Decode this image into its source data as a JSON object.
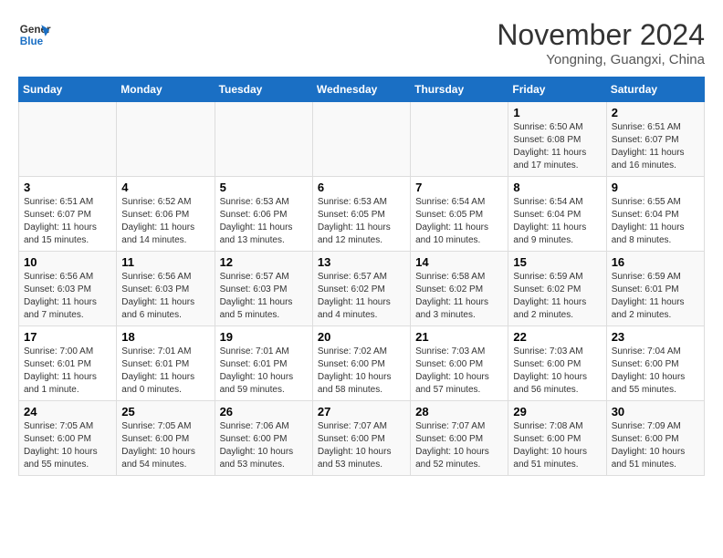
{
  "logo": {
    "line1": "General",
    "line2": "Blue"
  },
  "title": "November 2024",
  "subtitle": "Yongning, Guangxi, China",
  "weekdays": [
    "Sunday",
    "Monday",
    "Tuesday",
    "Wednesday",
    "Thursday",
    "Friday",
    "Saturday"
  ],
  "weeks": [
    [
      {
        "day": "",
        "info": ""
      },
      {
        "day": "",
        "info": ""
      },
      {
        "day": "",
        "info": ""
      },
      {
        "day": "",
        "info": ""
      },
      {
        "day": "",
        "info": ""
      },
      {
        "day": "1",
        "info": "Sunrise: 6:50 AM\nSunset: 6:08 PM\nDaylight: 11 hours and 17 minutes."
      },
      {
        "day": "2",
        "info": "Sunrise: 6:51 AM\nSunset: 6:07 PM\nDaylight: 11 hours and 16 minutes."
      }
    ],
    [
      {
        "day": "3",
        "info": "Sunrise: 6:51 AM\nSunset: 6:07 PM\nDaylight: 11 hours and 15 minutes."
      },
      {
        "day": "4",
        "info": "Sunrise: 6:52 AM\nSunset: 6:06 PM\nDaylight: 11 hours and 14 minutes."
      },
      {
        "day": "5",
        "info": "Sunrise: 6:53 AM\nSunset: 6:06 PM\nDaylight: 11 hours and 13 minutes."
      },
      {
        "day": "6",
        "info": "Sunrise: 6:53 AM\nSunset: 6:05 PM\nDaylight: 11 hours and 12 minutes."
      },
      {
        "day": "7",
        "info": "Sunrise: 6:54 AM\nSunset: 6:05 PM\nDaylight: 11 hours and 10 minutes."
      },
      {
        "day": "8",
        "info": "Sunrise: 6:54 AM\nSunset: 6:04 PM\nDaylight: 11 hours and 9 minutes."
      },
      {
        "day": "9",
        "info": "Sunrise: 6:55 AM\nSunset: 6:04 PM\nDaylight: 11 hours and 8 minutes."
      }
    ],
    [
      {
        "day": "10",
        "info": "Sunrise: 6:56 AM\nSunset: 6:03 PM\nDaylight: 11 hours and 7 minutes."
      },
      {
        "day": "11",
        "info": "Sunrise: 6:56 AM\nSunset: 6:03 PM\nDaylight: 11 hours and 6 minutes."
      },
      {
        "day": "12",
        "info": "Sunrise: 6:57 AM\nSunset: 6:03 PM\nDaylight: 11 hours and 5 minutes."
      },
      {
        "day": "13",
        "info": "Sunrise: 6:57 AM\nSunset: 6:02 PM\nDaylight: 11 hours and 4 minutes."
      },
      {
        "day": "14",
        "info": "Sunrise: 6:58 AM\nSunset: 6:02 PM\nDaylight: 11 hours and 3 minutes."
      },
      {
        "day": "15",
        "info": "Sunrise: 6:59 AM\nSunset: 6:02 PM\nDaylight: 11 hours and 2 minutes."
      },
      {
        "day": "16",
        "info": "Sunrise: 6:59 AM\nSunset: 6:01 PM\nDaylight: 11 hours and 2 minutes."
      }
    ],
    [
      {
        "day": "17",
        "info": "Sunrise: 7:00 AM\nSunset: 6:01 PM\nDaylight: 11 hours and 1 minute."
      },
      {
        "day": "18",
        "info": "Sunrise: 7:01 AM\nSunset: 6:01 PM\nDaylight: 11 hours and 0 minutes."
      },
      {
        "day": "19",
        "info": "Sunrise: 7:01 AM\nSunset: 6:01 PM\nDaylight: 10 hours and 59 minutes."
      },
      {
        "day": "20",
        "info": "Sunrise: 7:02 AM\nSunset: 6:00 PM\nDaylight: 10 hours and 58 minutes."
      },
      {
        "day": "21",
        "info": "Sunrise: 7:03 AM\nSunset: 6:00 PM\nDaylight: 10 hours and 57 minutes."
      },
      {
        "day": "22",
        "info": "Sunrise: 7:03 AM\nSunset: 6:00 PM\nDaylight: 10 hours and 56 minutes."
      },
      {
        "day": "23",
        "info": "Sunrise: 7:04 AM\nSunset: 6:00 PM\nDaylight: 10 hours and 55 minutes."
      }
    ],
    [
      {
        "day": "24",
        "info": "Sunrise: 7:05 AM\nSunset: 6:00 PM\nDaylight: 10 hours and 55 minutes."
      },
      {
        "day": "25",
        "info": "Sunrise: 7:05 AM\nSunset: 6:00 PM\nDaylight: 10 hours and 54 minutes."
      },
      {
        "day": "26",
        "info": "Sunrise: 7:06 AM\nSunset: 6:00 PM\nDaylight: 10 hours and 53 minutes."
      },
      {
        "day": "27",
        "info": "Sunrise: 7:07 AM\nSunset: 6:00 PM\nDaylight: 10 hours and 53 minutes."
      },
      {
        "day": "28",
        "info": "Sunrise: 7:07 AM\nSunset: 6:00 PM\nDaylight: 10 hours and 52 minutes."
      },
      {
        "day": "29",
        "info": "Sunrise: 7:08 AM\nSunset: 6:00 PM\nDaylight: 10 hours and 51 minutes."
      },
      {
        "day": "30",
        "info": "Sunrise: 7:09 AM\nSunset: 6:00 PM\nDaylight: 10 hours and 51 minutes."
      }
    ]
  ]
}
